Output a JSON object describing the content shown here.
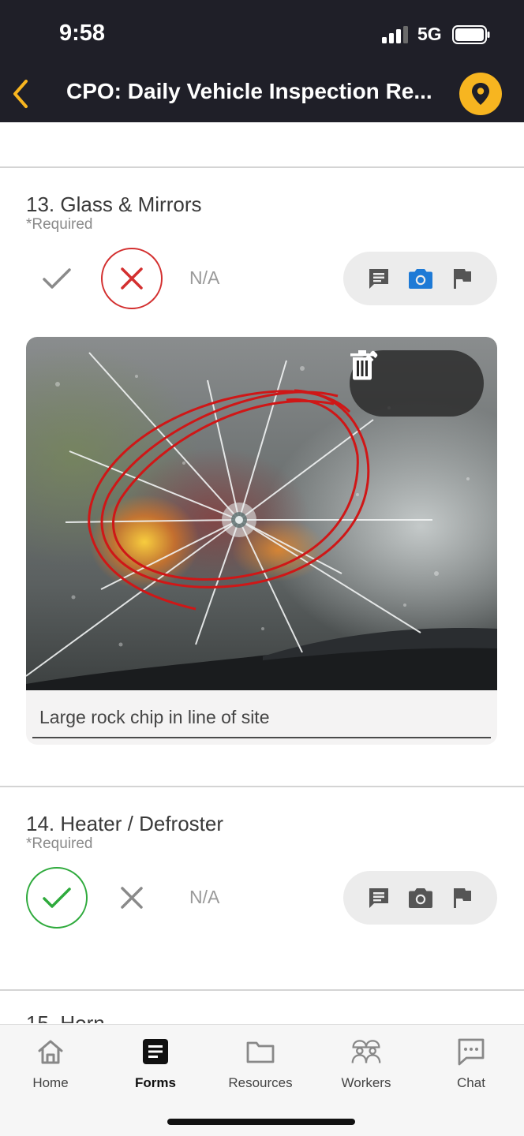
{
  "status_bar": {
    "time": "9:58",
    "network": "5G"
  },
  "header": {
    "title": "CPO: Daily Vehicle Inspection Re...",
    "accent": "#f7b520",
    "background": "#1f1f28"
  },
  "questions": [
    {
      "title": "13. Glass & Mirrors",
      "required_label": "*Required",
      "selected": "fail",
      "na_label": "N/A",
      "tools": [
        "comment-icon",
        "camera-icon",
        "flag-icon"
      ],
      "camera_active": true,
      "photo": {
        "caption": "Large rock chip in line of site"
      }
    },
    {
      "title": "14. Heater / Defroster",
      "required_label": "*Required",
      "selected": "pass",
      "na_label": "N/A",
      "tools": [
        "comment-icon",
        "camera-icon",
        "flag-icon"
      ],
      "camera_active": false
    }
  ],
  "next_question_peek": "15. Horn",
  "tabbar": {
    "active": "Forms",
    "items": [
      {
        "label": "Home",
        "icon": "home-icon"
      },
      {
        "label": "Forms",
        "icon": "forms-icon"
      },
      {
        "label": "Resources",
        "icon": "folder-icon"
      },
      {
        "label": "Workers",
        "icon": "workers-icon"
      },
      {
        "label": "Chat",
        "icon": "chat-icon"
      }
    ]
  },
  "colors": {
    "fail": "#d32f2f",
    "pass": "#2eaa3c",
    "camera_active": "#1e7ad6"
  }
}
